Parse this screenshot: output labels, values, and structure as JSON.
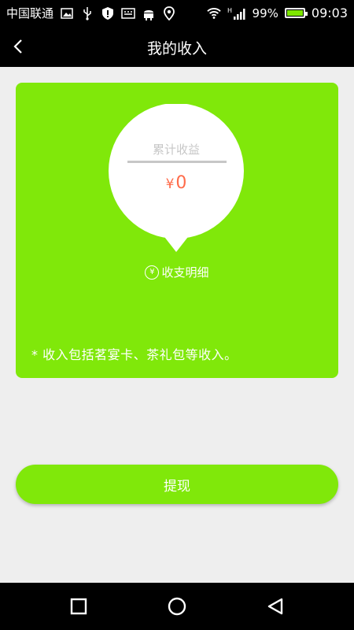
{
  "status_bar": {
    "carrier": "中国联通",
    "battery_text": "99%",
    "time": "09:03",
    "battery_level": 0.99,
    "network_label": "H"
  },
  "header": {
    "title": "我的收入"
  },
  "income_card": {
    "label": "累计收益",
    "currency_symbol": "¥",
    "amount": "0",
    "detail_link": "收支明细",
    "detail_icon_symbol": "¥",
    "note": "* 收入包括茗宴卡、茶礼包等收入。"
  },
  "actions": {
    "withdraw_label": "提现"
  },
  "colors": {
    "accent_green": "#80e80a",
    "amount_color": "#ff6b4a",
    "background": "#eeeeee"
  }
}
